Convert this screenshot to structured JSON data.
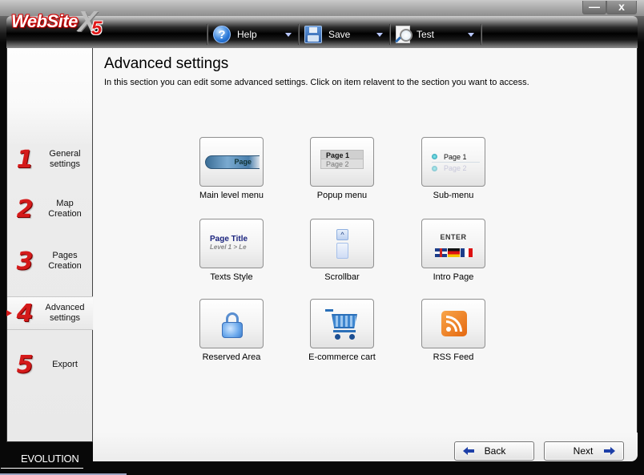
{
  "window": {
    "controls": {
      "minimize": "—",
      "close": "x"
    }
  },
  "logo": {
    "text": "WebSite",
    "x": "X",
    "version": "5"
  },
  "toolbar": {
    "items": [
      {
        "label": "Help",
        "icon": "help-icon"
      },
      {
        "label": "Save",
        "icon": "save-icon"
      },
      {
        "label": "Test",
        "icon": "test-magnifier-icon"
      }
    ]
  },
  "sidebar": {
    "items": [
      {
        "number": "1",
        "label_line1": "General",
        "label_line2": "settings",
        "active": false
      },
      {
        "number": "2",
        "label_line1": "Map",
        "label_line2": "Creation",
        "active": false
      },
      {
        "number": "3",
        "label_line1": "Pages",
        "label_line2": "Creation",
        "active": false
      },
      {
        "number": "4",
        "label_line1": "Advanced",
        "label_line2": "settings",
        "active": true
      },
      {
        "number": "5",
        "label_line1": "Export",
        "label_line2": "",
        "active": false
      }
    ]
  },
  "main": {
    "title": "Advanced settings",
    "description": "In this section you can edit some advanced settings. Click on item relavent to the section you want to access.",
    "tiles": [
      {
        "label": "Main level menu",
        "preview_text": "Page"
      },
      {
        "label": "Popup menu",
        "preview_items": [
          "Page 1",
          "Page 2"
        ]
      },
      {
        "label": "Sub-menu",
        "preview_items": [
          "Page 1",
          "Page 2"
        ]
      },
      {
        "label": "Texts Style",
        "preview_title": "Page Title",
        "preview_path": "Level 1 > Le"
      },
      {
        "label": "Scrollbar",
        "preview_arrow": "^"
      },
      {
        "label": "Intro Page",
        "preview_text": "ENTER"
      },
      {
        "label": "Reserved Area"
      },
      {
        "label": "E-commerce cart"
      },
      {
        "label": "RSS Feed"
      }
    ]
  },
  "footer": {
    "brand": "EVOLUTION",
    "back_label": "Back",
    "next_label": "Next"
  }
}
